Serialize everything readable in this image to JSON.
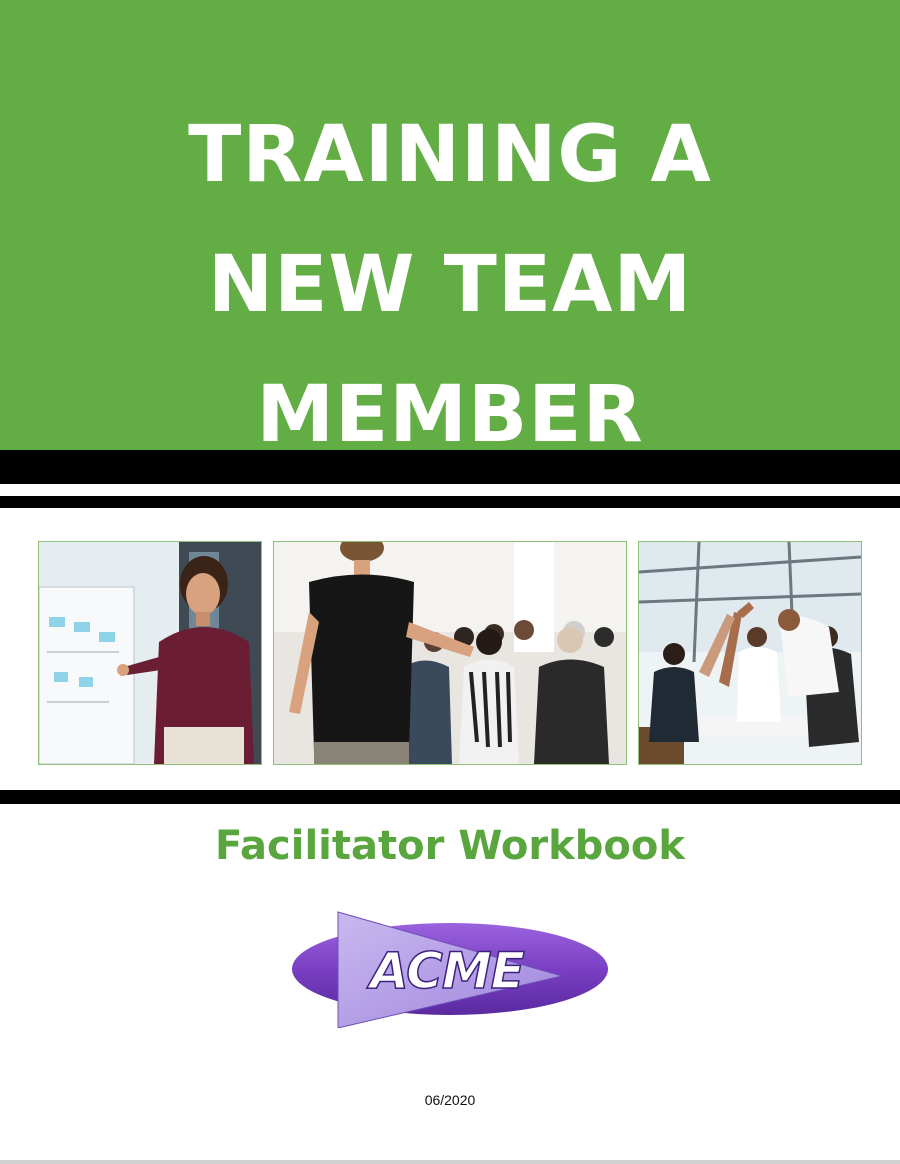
{
  "cover": {
    "title_lines": [
      "TRAINING A",
      "NEW TEAM",
      "MEMBER"
    ],
    "subtitle": "Facilitator Workbook",
    "date": "06/2020",
    "logo_text": "ACME"
  },
  "colors": {
    "brand_green": "#63ad45",
    "subtitle_green": "#5aa63e",
    "stripe": "#000000",
    "logo_purple": "#7a3fc4",
    "logo_lavender": "#b7a4e6"
  },
  "photos": [
    {
      "name": "presenter-at-whiteboard-photo"
    },
    {
      "name": "audience-seminar-photo"
    },
    {
      "name": "team-high-five-photo"
    }
  ]
}
